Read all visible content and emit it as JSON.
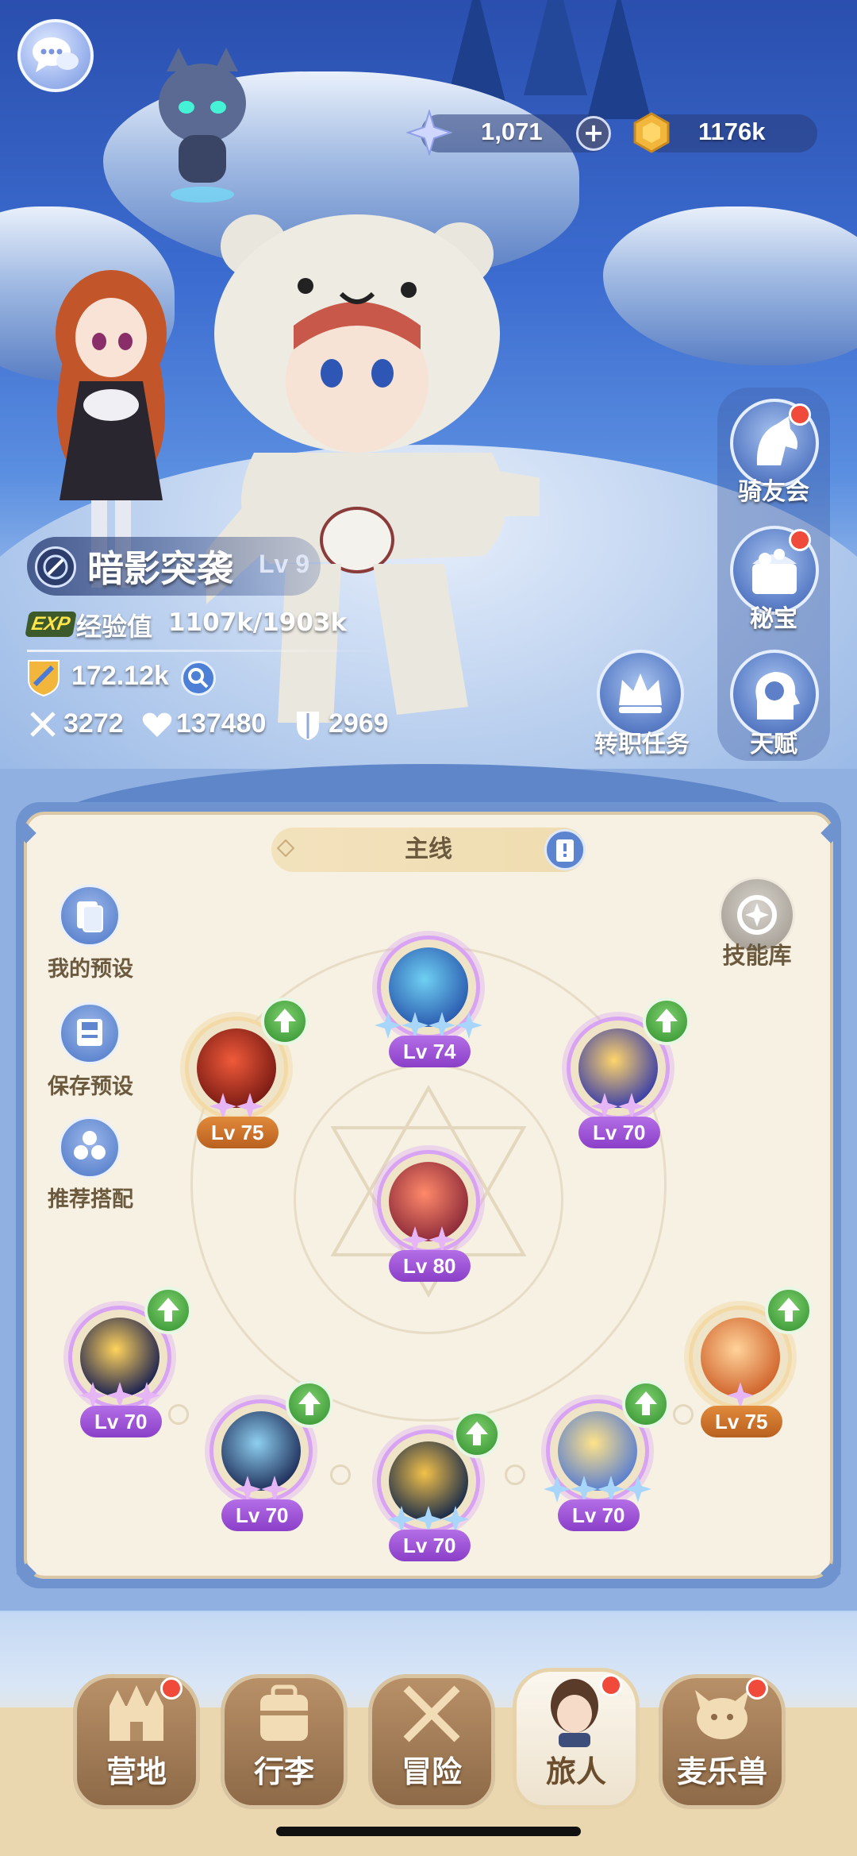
{
  "currency": {
    "gems": "1,071",
    "gold": "1176k"
  },
  "side_menu": [
    {
      "label": "骑友会",
      "icon": "horse-icon",
      "badge": true
    },
    {
      "label": "秘宝",
      "icon": "treasure-chest-icon",
      "badge": true
    },
    {
      "label": "天赋",
      "icon": "brain-head-icon",
      "badge": false
    }
  ],
  "job_quest": {
    "label": "转职任务",
    "icon": "crown-icon"
  },
  "character": {
    "class_name": "暗影突袭",
    "level": "Lv 9",
    "exp_badge": "EXP",
    "exp_label": "经验值",
    "exp_value": "1107k/1903k",
    "power": "172.12k",
    "attack": "3272",
    "hp": "137480",
    "defense": "2969"
  },
  "skill_panel": {
    "tab_label": "主线",
    "left_buttons": [
      {
        "label": "我的预设",
        "icon": "preset-cards-icon"
      },
      {
        "label": "保存预设",
        "icon": "save-disk-icon"
      },
      {
        "label": "推荐搭配",
        "icon": "recommend-combo-icon"
      }
    ],
    "skill_library": {
      "label": "技能库",
      "icon": "skill-library-icon"
    },
    "skills": [
      {
        "id": "top-center",
        "level": "Lv 74",
        "stars": 4,
        "star_color": "blue",
        "upgrade": false,
        "pill": "purple",
        "art": [
          "#6fd0f2",
          "#2b5bb0"
        ]
      },
      {
        "id": "upper-left",
        "level": "Lv 75",
        "stars": 2,
        "star_color": "pink",
        "upgrade": true,
        "pill": "orange",
        "art": [
          "#f05a3a",
          "#7a1b14"
        ]
      },
      {
        "id": "upper-right",
        "level": "Lv 70",
        "stars": 2,
        "star_color": "pink",
        "upgrade": true,
        "pill": "purple",
        "art": [
          "#ffd56a",
          "#3b3fa8"
        ]
      },
      {
        "id": "center",
        "level": "Lv 80",
        "stars": 2,
        "star_color": "pink",
        "upgrade": false,
        "pill": "purple",
        "art": [
          "#ff8a6a",
          "#8d2a3a"
        ]
      },
      {
        "id": "lower-far-left",
        "level": "Lv 70",
        "stars": 3,
        "star_color": "pink",
        "upgrade": true,
        "pill": "purple",
        "art": [
          "#ffd35c",
          "#1c2250"
        ]
      },
      {
        "id": "lower-left",
        "level": "Lv 70",
        "stars": 2,
        "star_color": "pink",
        "upgrade": true,
        "pill": "purple",
        "art": [
          "#8ecff0",
          "#1f2f5a"
        ]
      },
      {
        "id": "lower-center",
        "level": "Lv 70",
        "stars": 3,
        "star_color": "blue",
        "upgrade": true,
        "pill": "purple",
        "art": [
          "#f3c14a",
          "#1a2c4a"
        ]
      },
      {
        "id": "lower-right",
        "level": "Lv 70",
        "stars": 4,
        "star_color": "blue",
        "upgrade": true,
        "pill": "purple",
        "art": [
          "#ffe38a",
          "#5a7fd0"
        ]
      },
      {
        "id": "lower-far-right",
        "level": "Lv 75",
        "stars": 1,
        "star_color": "pink",
        "upgrade": true,
        "pill": "orange",
        "art": [
          "#ffd39a",
          "#d0642c"
        ]
      }
    ]
  },
  "bottom_nav": [
    {
      "label": "营地",
      "icon": "castle-icon",
      "active": false,
      "badge": true
    },
    {
      "label": "行李",
      "icon": "backpack-icon",
      "active": false,
      "badge": false
    },
    {
      "label": "冒险",
      "icon": "crossed-swords-icon",
      "active": false,
      "badge": false
    },
    {
      "label": "旅人",
      "icon": "traveler-avatar-icon",
      "active": true,
      "badge": true
    },
    {
      "label": "麦乐兽",
      "icon": "pet-cat-icon",
      "active": false,
      "badge": true
    }
  ],
  "colors": {
    "accent_blue": "#5d84cf",
    "board_cream": "#f7f1e4",
    "text_brown": "#6c5a3f",
    "upgrade_green": "#3f9c3a",
    "badge_red": "#f04a3a"
  }
}
